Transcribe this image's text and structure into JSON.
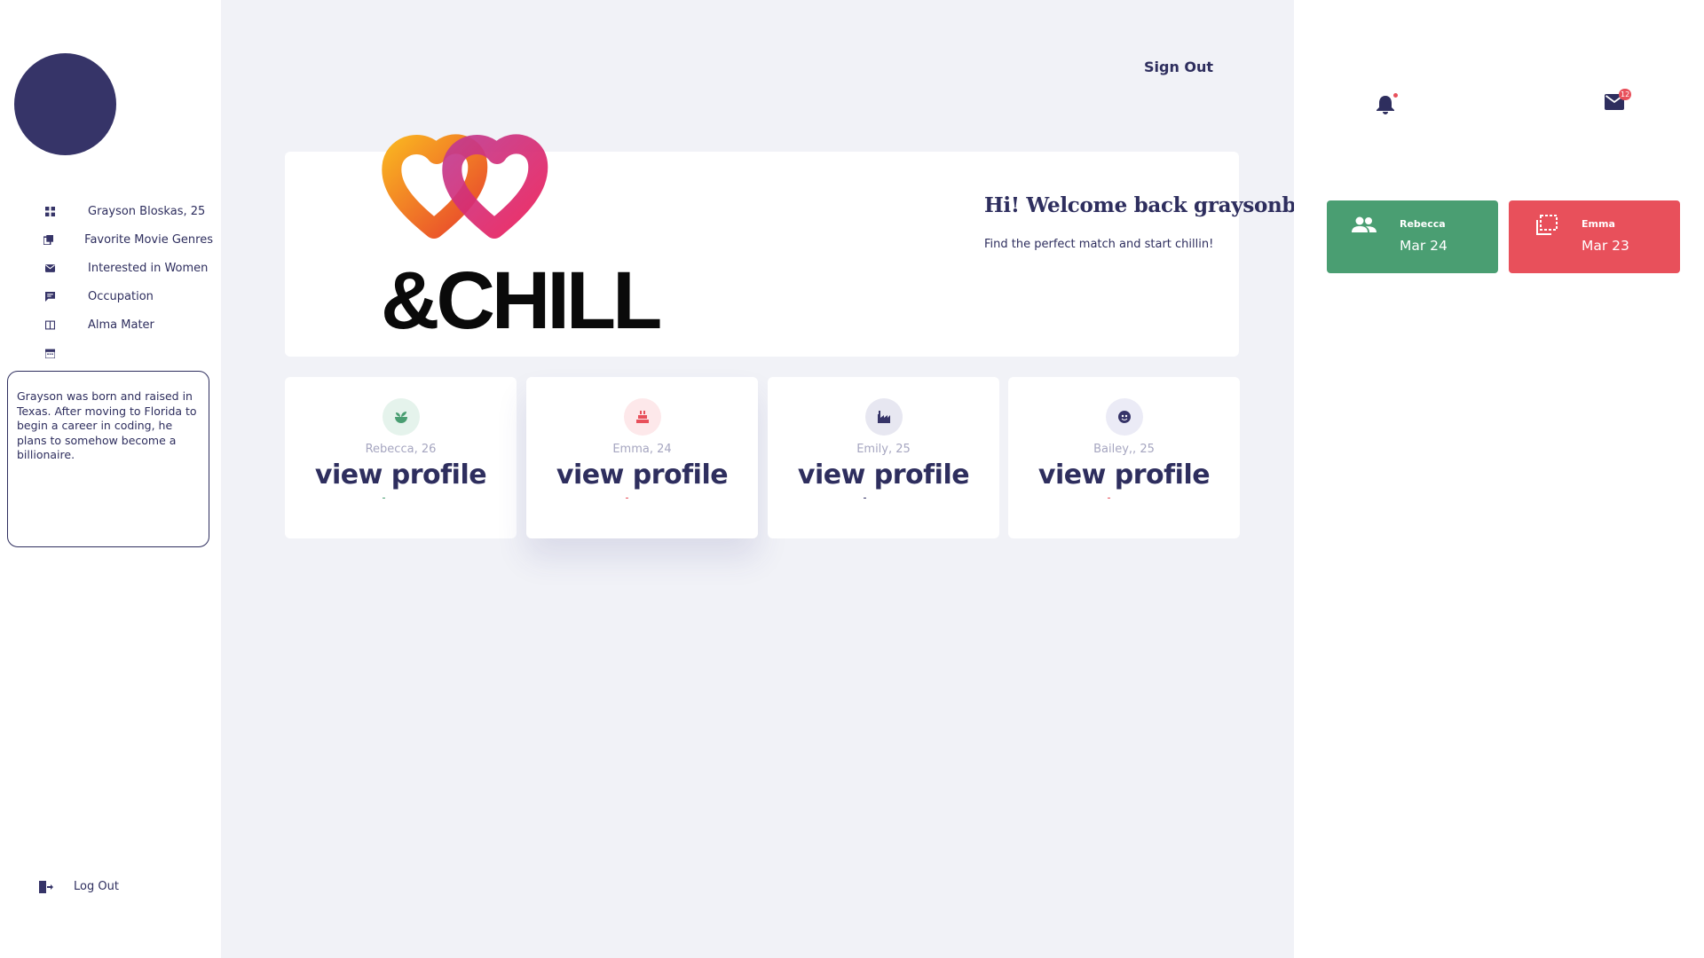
{
  "sidebar": {
    "items": [
      {
        "label": "Grayson Bloskas, 25",
        "icon": "dashboard-icon"
      },
      {
        "label": "Favorite Movie Genres",
        "icon": "library-icon"
      },
      {
        "label": "Interested in Women",
        "icon": "mail-icon"
      },
      {
        "label": "Occupation",
        "icon": "chat-icon"
      },
      {
        "label": "Alma Mater",
        "icon": "book-icon"
      },
      {
        "label": "",
        "icon": "calendar-icon"
      }
    ],
    "bio": "Grayson was born and raised in Texas. After moving to Florida to begin a career in coding, he plans to somehow become a billionaire.",
    "logout_label": "Log Out"
  },
  "header": {
    "signout_label": "Sign Out"
  },
  "welcome": {
    "logo_text": "&CHILL",
    "title": "Hi! Welcome back graysonbloskas",
    "subtitle": "Find the perfect match and start chillin!"
  },
  "profiles": [
    {
      "name": "Rebecca, 26",
      "view_label": "view profile",
      "icon_bg": "#e5f3ec",
      "icon_color": "#4a9e72",
      "dash_color": "#4a9e72"
    },
    {
      "name": "Emma, 24",
      "view_label": "view profile",
      "icon_bg": "#fde8ea",
      "icon_color": "#e8505b",
      "dash_color": "#e8505b"
    },
    {
      "name": "Emily, 25",
      "view_label": "view profile",
      "icon_bg": "#e7e7f1",
      "icon_color": "#363468",
      "dash_color": "#363468"
    },
    {
      "name": "Bailey,, 25",
      "view_label": "view profile",
      "icon_bg": "#ebebf6",
      "icon_color": "#363468",
      "dash_color": "#e8505b"
    }
  ],
  "notifications": {
    "mail_count": "12"
  },
  "events": [
    {
      "name": "Rebecca",
      "date": "Mar 24",
      "color": "#4a9e72",
      "icon": "people-icon"
    },
    {
      "name": "Emma",
      "date": "Mar 23",
      "color": "#e8505b",
      "icon": "selection-icon"
    }
  ]
}
